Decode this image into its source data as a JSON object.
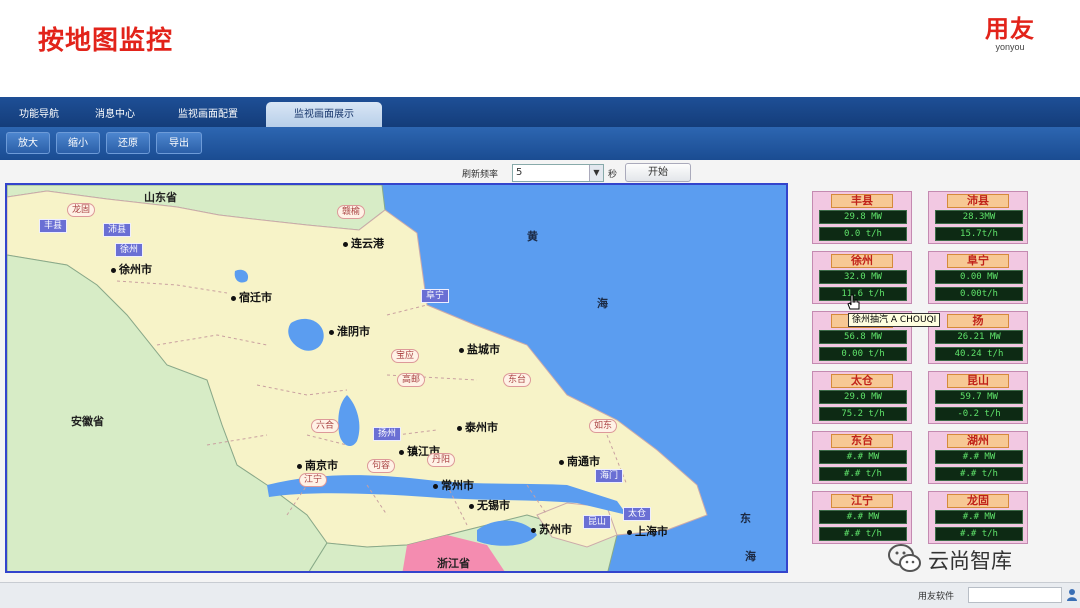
{
  "slide": {
    "title": "按地图监控"
  },
  "logo": {
    "text": "用友",
    "subtext": "yonyou"
  },
  "tabs": [
    {
      "label": "功能导航",
      "active": false
    },
    {
      "label": "消息中心",
      "active": false
    },
    {
      "label": "监视画面配置",
      "active": false
    },
    {
      "label": "监视画面展示",
      "active": true
    }
  ],
  "toolbar": {
    "buttons": [
      "放大",
      "缩小",
      "还原",
      "导出"
    ]
  },
  "controls": {
    "freq_label": "刷新频率",
    "freq_value": "5",
    "unit": "秒",
    "start_label": "开始"
  },
  "map": {
    "regions": [
      "山东省",
      "安徽省",
      "浙江省"
    ],
    "sea": [
      "黄",
      "海",
      "东",
      "海"
    ],
    "cities": [
      "连云港",
      "宿迁市",
      "徐州市",
      "淮阴市",
      "盐城市",
      "扬州",
      "泰州市",
      "镇江市",
      "南京市",
      "常州市",
      "无锡市",
      "苏州市",
      "南通市",
      "上海市"
    ],
    "stations_blue": [
      "丰县",
      "沛县",
      "徐州",
      "阜宁",
      "扬州",
      "海门",
      "昆山",
      "太仓"
    ],
    "stations_pink": [
      "龙固",
      "赣榆",
      "宝应",
      "高邮",
      "东台",
      "六合",
      "句容",
      "丹阳",
      "如东",
      "江宁"
    ]
  },
  "cards": [
    {
      "name": "丰县",
      "line1": "29.8 MW",
      "line2": "0.0 t/h"
    },
    {
      "name": "沛县",
      "line1": "28.3MW",
      "line2": "15.7t/h"
    },
    {
      "name": "徐州",
      "line1": "32.0 MW",
      "line2": "11.6 t/h"
    },
    {
      "name": "阜宁",
      "line1": "0.00 MW",
      "line2": "0.00t/h"
    },
    {
      "name": "扬",
      "line1": "56.8 MW",
      "line2": "0.00 t/h"
    },
    {
      "name": "扬",
      "line1": "26.21 MW",
      "line2": "40.24 t/h"
    },
    {
      "name": "太仓",
      "line1": "29.0 MW",
      "line2": "75.2 t/h"
    },
    {
      "name": "昆山",
      "line1": "59.7 MW",
      "line2": "-0.2 t/h"
    },
    {
      "name": "东台",
      "line1": "#.# MW",
      "line2": "#.# t/h"
    },
    {
      "name": "湖州",
      "line1": "#.# MW",
      "line2": "#.# t/h"
    },
    {
      "name": "江宁",
      "line1": "#.# MW",
      "line2": "#.# t/h"
    },
    {
      "name": "龙固",
      "line1": "#.# MW",
      "line2": "#.# t/h"
    }
  ],
  "tooltip": "徐州抽汽 A CHOUQI",
  "status": {
    "text": "用友软件"
  },
  "watermark": {
    "text": "云尚智库"
  },
  "colors": {
    "title_red": "#e2231a",
    "tab_blue": "#1e4f96",
    "sea_blue": "#5b9df0",
    "land_yellow": "#f7f3c8",
    "card_pink": "#f2c8e2",
    "lcd_green": "#5fe26a"
  }
}
